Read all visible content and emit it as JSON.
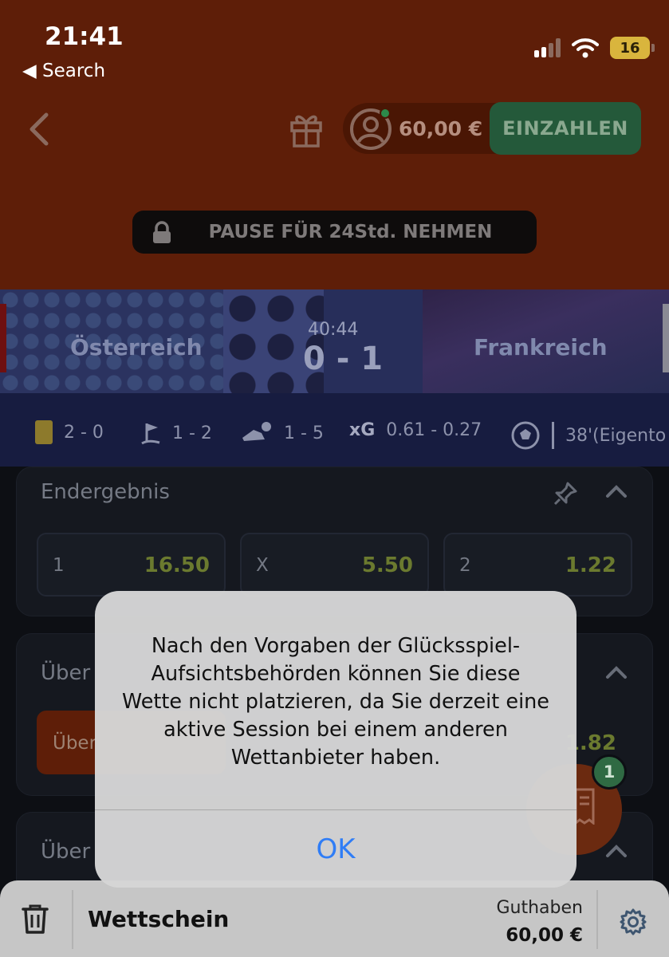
{
  "status_bar": {
    "time": "21:41",
    "back_label": "◀ Search",
    "battery": "16"
  },
  "header": {
    "balance": "60,00 €",
    "deposit_label": "EINZAHLEN",
    "pause_label": "PAUSE FÜR 24Std. NEHMEN"
  },
  "match": {
    "home_team": "Österreich",
    "away_team": "Frankreich",
    "time": "40:44",
    "score": "0 - 1"
  },
  "stats": {
    "cards": "2 - 0",
    "corners": "1 - 2",
    "shots": "1 - 5",
    "xg_label": "xG",
    "xg": "0.61 - 0.27",
    "goal_event": "38'(Eigento"
  },
  "markets": [
    {
      "title": "Endergebnis",
      "odds": [
        {
          "label": "1",
          "value": "16.50"
        },
        {
          "label": "X",
          "value": "5.50"
        },
        {
          "label": "2",
          "value": "1.22"
        }
      ]
    },
    {
      "title": "Über",
      "selected_label": "Über",
      "selected_value_partial": "1.82"
    },
    {
      "title": "Über"
    }
  ],
  "fab": {
    "badge": "1"
  },
  "betslip": {
    "title": "Wettschein",
    "balance_label": "Guthaben",
    "balance_value": "60,00 €"
  },
  "alert": {
    "message": "Nach den Vorgaben der Glücksspiel-Aufsichtsbehörden können Sie diese Wette nicht platzieren, da Sie derzeit eine aktive Session bei einem anderen Wettanbieter haben.",
    "ok_label": "OK"
  },
  "colors": {
    "header_bg": "#5e1e08",
    "deposit_bg": "#24593a",
    "ios_blue": "#2f7df6"
  }
}
